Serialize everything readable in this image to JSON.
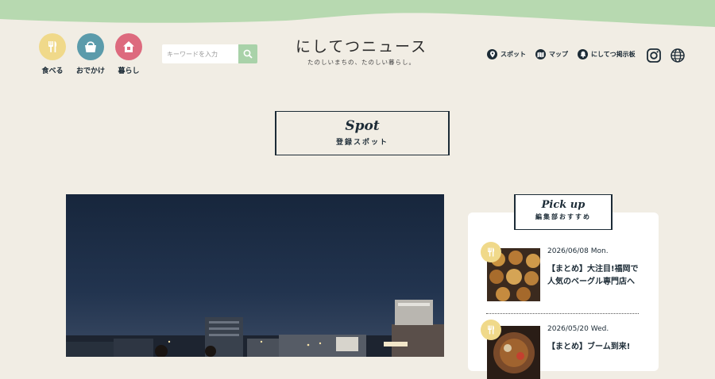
{
  "colors": {
    "background": "#f1ede4",
    "wave": "#b7d9b0",
    "navy": "#1c2b36",
    "cat_food": "#f0d98a",
    "cat_out": "#5b9bab",
    "cat_life": "#dd6a7e",
    "search_button": "#a9d2a9"
  },
  "categories": [
    {
      "label": "食べる",
      "icon": "fork-knife-icon"
    },
    {
      "label": "おでかけ",
      "icon": "bag-icon"
    },
    {
      "label": "暮らし",
      "icon": "house-icon"
    }
  ],
  "search": {
    "placeholder": "キーワードを入力",
    "icon": "search-icon"
  },
  "logo": {
    "name": "にしてつニュース",
    "tagline": "たのしいまちの、たのしい暮らし。"
  },
  "nav": [
    {
      "label": "スポット",
      "icon": "map-pin-icon"
    },
    {
      "label": "マップ",
      "icon": "map-icon"
    },
    {
      "label": "にしてつ掲示板",
      "icon": "bell-icon"
    }
  ],
  "social": [
    {
      "icon": "instagram-icon"
    },
    {
      "icon": "globe-icon"
    }
  ],
  "page_title": {
    "en": "Spot",
    "ja": "登録スポット"
  },
  "pickup": {
    "title_en": "Pick up",
    "title_ja": "編集部おすすめ",
    "articles": [
      {
        "date": "2026/06/08 Mon.",
        "headline": "【まとめ】大注目!福岡で人気のベーグル専門店へ",
        "category_icon": "fork-knife-icon"
      },
      {
        "date": "2026/05/20 Wed.",
        "headline": "【まとめ】ブーム到来!",
        "category_icon": "fork-knife-icon"
      }
    ]
  }
}
